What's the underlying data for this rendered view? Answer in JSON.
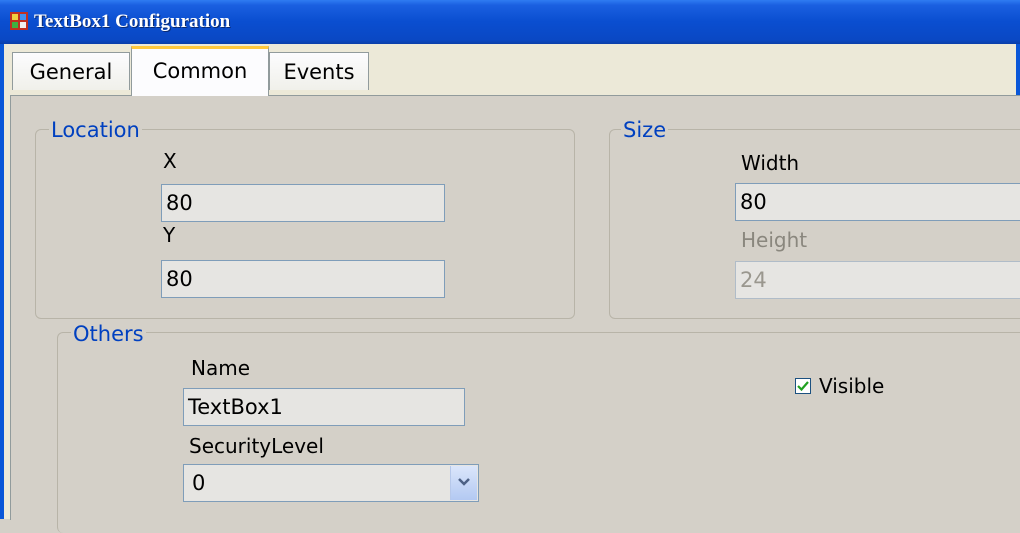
{
  "window": {
    "title": "TextBox1 Configuration"
  },
  "tabs": [
    {
      "label": "General"
    },
    {
      "label": "Common"
    },
    {
      "label": "Events"
    }
  ],
  "active_tab": "Common",
  "location": {
    "legend": "Location",
    "x_label": "X",
    "x_value": "80",
    "y_label": "Y",
    "y_value": "80"
  },
  "size": {
    "legend": "Size",
    "width_label": "Width",
    "width_value": "80",
    "height_label": "Height",
    "height_value": "24"
  },
  "others": {
    "legend": "Others",
    "name_label": "Name",
    "name_value": "TextBox1",
    "security_label": "SecurityLevel",
    "security_value": "0",
    "visible_label": "Visible",
    "visible_checked": true
  },
  "colors": {
    "titlebar": "#0a4ed0",
    "legend_text": "#0040c0",
    "active_tab_accent": "#ffc83c"
  }
}
